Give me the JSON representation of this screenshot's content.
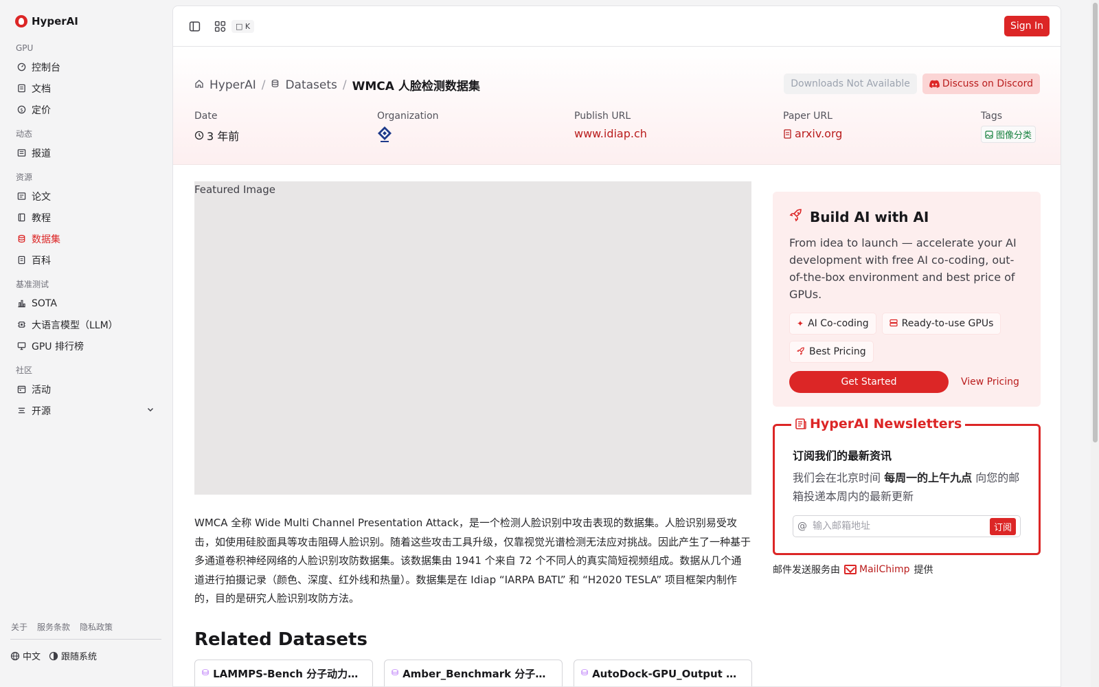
{
  "app": {
    "name": "HyperAI"
  },
  "sidebar": {
    "sections": [
      {
        "title": "GPU",
        "items": [
          {
            "label": "控制台",
            "icon": "gauge-icon"
          },
          {
            "label": "文档",
            "icon": "doc-icon"
          },
          {
            "label": "定价",
            "icon": "dollar-icon"
          }
        ]
      },
      {
        "title": "动态",
        "items": [
          {
            "label": "报道",
            "icon": "news-icon"
          }
        ]
      },
      {
        "title": "资源",
        "items": [
          {
            "label": "论文",
            "icon": "paper-icon"
          },
          {
            "label": "教程",
            "icon": "book-icon"
          },
          {
            "label": "数据集",
            "icon": "database-icon",
            "active": true
          },
          {
            "label": "百科",
            "icon": "wiki-icon"
          }
        ]
      },
      {
        "title": "基准测试",
        "items": [
          {
            "label": "SOTA",
            "icon": "chart-icon"
          },
          {
            "label": "大语言模型（LLM）",
            "icon": "chip-icon"
          },
          {
            "label": "GPU 排行榜",
            "icon": "monitor-icon"
          }
        ]
      },
      {
        "title": "社区",
        "items": [
          {
            "label": "活动",
            "icon": "calendar-icon"
          },
          {
            "label": "开源",
            "icon": "list-icon",
            "expandable": true
          }
        ]
      }
    ],
    "footer_links": [
      "关于",
      "服务条款",
      "隐私政策"
    ],
    "language": "中文",
    "theme": "跟随系统"
  },
  "topbar": {
    "kbd": "K",
    "signin": "Sign In"
  },
  "hero": {
    "breadcrumb": [
      "HyperAI",
      "Datasets",
      "WMCA 人脸检测数据集"
    ],
    "downloads": "Downloads Not Available",
    "discord": "Discuss on Discord",
    "meta": {
      "date_label": "Date",
      "date_value": "3 年前",
      "org_label": "Organization",
      "publish_label": "Publish URL",
      "publish_value": "www.idiap.ch",
      "paper_label": "Paper URL",
      "paper_value": "arxiv.org",
      "tags_label": "Tags",
      "tag_value": "图像分类"
    }
  },
  "content": {
    "featured_alt": "Featured Image",
    "description": "WMCA 全称 Wide Multi Channel Presentation Attack，是一个检测人脸识别中攻击表现的数据集。人脸识别易受攻击，如使用硅胶面具等攻击阻碍人脸识别。随着这些攻击工具升级，仅靠视觉光谱检测无法应对挑战。因此产生了一种基于多通道卷积神经网络的人脸识别攻防数据集。该数据集由 1941 个来自 72 个不同人的真实简短视频组成。数据从几个通道进行拍摄记录（颜色、深度、红外线和热量）。数据集是在 Idiap “IARPA BATL” 和 “H2020 TESLA” 项目框架内制作的，目的是研究人脸识别攻防方法。",
    "related_title": "Related Datasets",
    "related": [
      "LAMMPS-Bench 分子动力学基准数据集",
      "Amber_Benchmark 分子动力学基准数据集",
      "AutoDock-GPU_Output 分子对接数据集"
    ]
  },
  "build": {
    "title": "Build AI with AI",
    "text": "From idea to launch — accelerate your AI development with free AI co-coding, out-of-the-box environment and best price of GPUs.",
    "chips": [
      "AI Co-coding",
      "Ready-to-use GPUs",
      "Best Pricing"
    ],
    "get_started": "Get Started",
    "view_pricing": "View Pricing"
  },
  "newsletter": {
    "legend": "HyperAI Newsletters",
    "heading": "订阅我们的最新资讯",
    "text_pre": "我们会在北京时间 ",
    "text_bold": "每周一的上午九点",
    "text_post": " 向您的邮箱投递本周内的最新更新",
    "placeholder": "输入邮箱地址",
    "subscribe": "订阅",
    "powered_pre": "邮件发送服务由",
    "powered_brand": "MailChimp",
    "powered_post": "提供"
  }
}
